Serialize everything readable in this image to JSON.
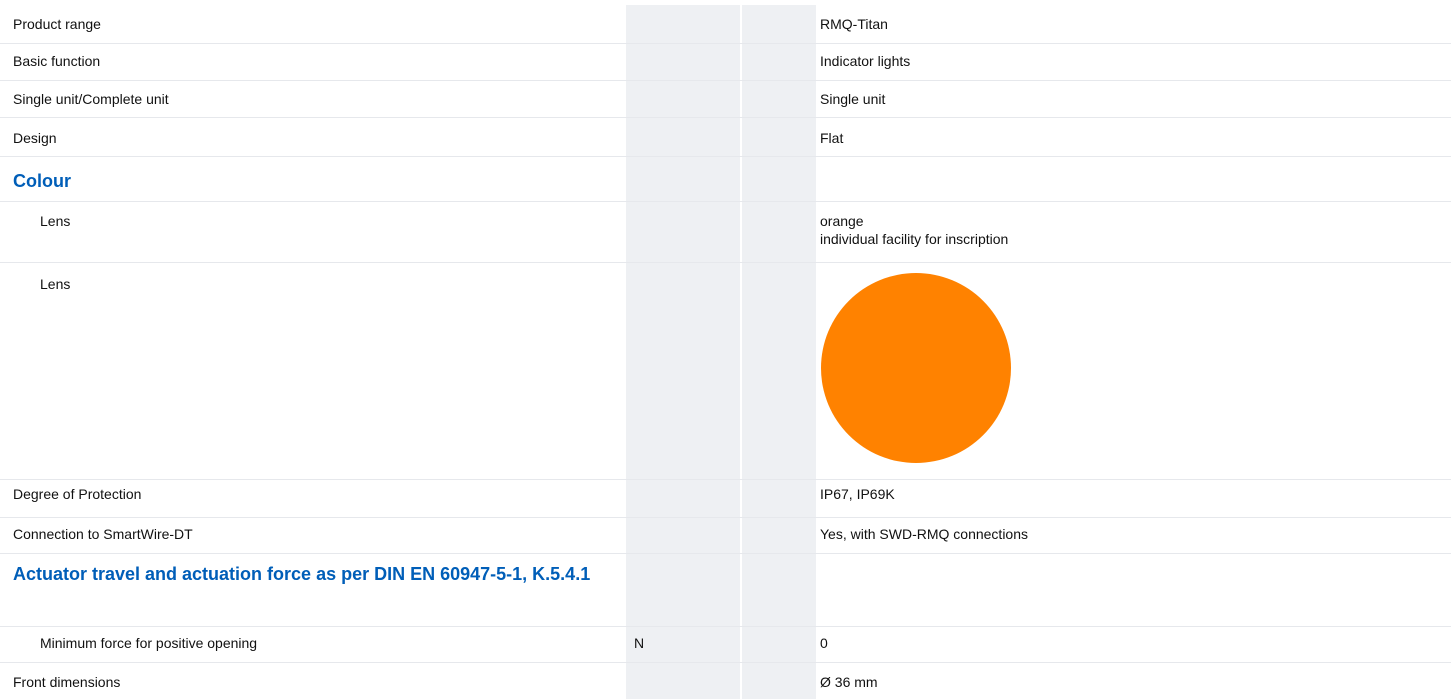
{
  "lens_color": "#ff8200",
  "rows": [
    {
      "label": "Product range",
      "unit": "",
      "value": "RMQ-Titan"
    },
    {
      "label": "Basic function",
      "unit": "",
      "value": "Indicator lights"
    },
    {
      "label": "Single unit/Complete unit",
      "unit": "",
      "value": "Single unit"
    },
    {
      "label": "Design",
      "unit": "",
      "value": "Flat"
    },
    {
      "label": "Colour"
    },
    {
      "label": "Lens",
      "unit": "",
      "value": "orange",
      "value2": "individual facility for inscription"
    },
    {
      "label": "Lens"
    },
    {
      "label": "Degree of Protection",
      "unit": "",
      "value": "IP67, IP69K"
    },
    {
      "label": "Connection to SmartWire-DT",
      "unit": "",
      "value": "Yes, with SWD-RMQ connections"
    },
    {
      "label": "Actuator travel and actuation force as per DIN EN 60947-5-1, K.5.4.1"
    },
    {
      "label": "Minimum force for positive opening",
      "unit": "N",
      "value": "0"
    },
    {
      "label": "Front dimensions",
      "unit": "",
      "value": "Ø 36 mm"
    }
  ]
}
